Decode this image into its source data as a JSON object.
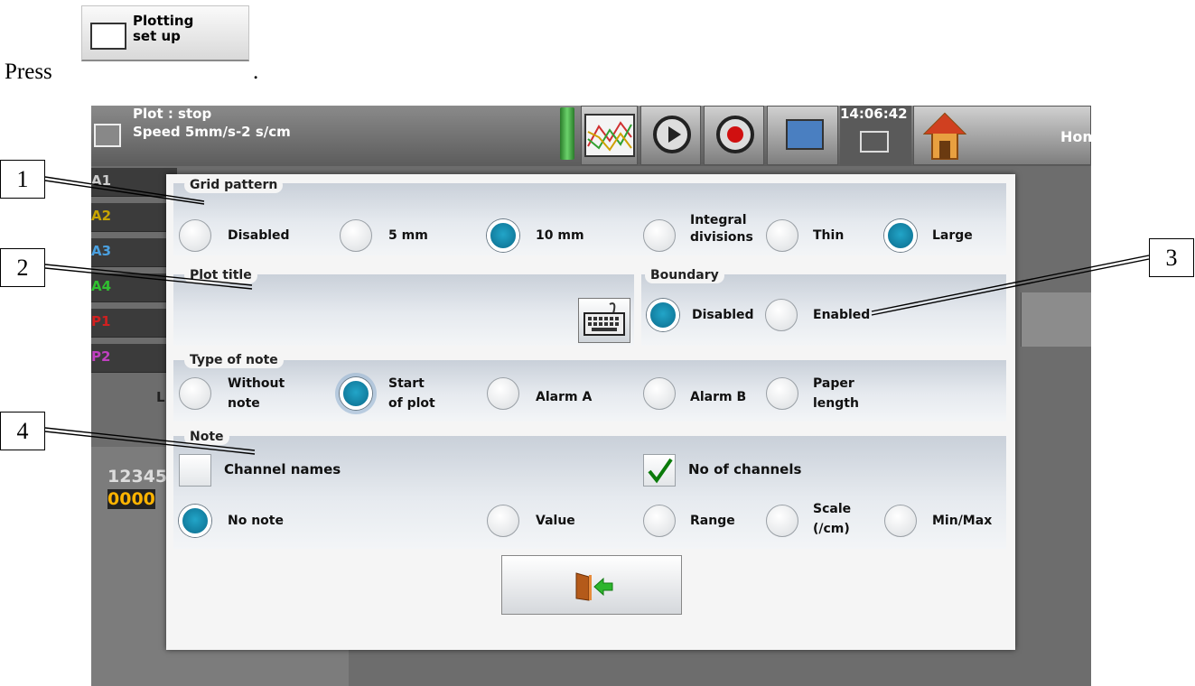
{
  "instruction": {
    "press_word": "Press",
    "button_label_line1": "Plotting",
    "button_label_line2": "set up",
    "period": "."
  },
  "status": {
    "line1": "Plot : stop",
    "line2": "Speed 5mm/s-2 s/cm"
  },
  "toolbar": {
    "icons": [
      "chart-icon",
      "play-icon",
      "record-icon",
      "monitor-icon"
    ],
    "clock": "14:06:42",
    "home_label": "Home"
  },
  "background": {
    "channels": [
      {
        "label": "A1",
        "color": "#cccccc"
      },
      {
        "label": "A2",
        "color": "#c8a400"
      },
      {
        "label": "A3",
        "color": "#4aa0e0"
      },
      {
        "label": "A4",
        "color": "#30c030"
      },
      {
        "label": "P1",
        "color": "#d02020"
      },
      {
        "label": "P2",
        "color": "#c040c0"
      }
    ],
    "low_letter": "L",
    "number1": "12345",
    "number2": "0000"
  },
  "dialog": {
    "grid": {
      "title": "Grid pattern",
      "options": [
        {
          "label": "Disabled",
          "selected": false
        },
        {
          "label": "5 mm",
          "selected": false
        },
        {
          "label": "10 mm",
          "selected": true
        },
        {
          "label": "Integral divisions",
          "line1": "Integral",
          "line2": "divisions",
          "selected": false
        },
        {
          "label": "Thin",
          "selected": false
        },
        {
          "label": "Large",
          "selected": true
        }
      ]
    },
    "plot_title": {
      "title": "Plot title",
      "value": ""
    },
    "boundary": {
      "title": "Boundary",
      "options": [
        {
          "label": "Disabled",
          "selected": true
        },
        {
          "label": "Enabled",
          "selected": false
        }
      ]
    },
    "type_of_note": {
      "title": "Type of note",
      "options": [
        {
          "line1": "Without",
          "line2": "note",
          "selected": false
        },
        {
          "line1": "Start",
          "line2": "of plot",
          "selected": true
        },
        {
          "label": "Alarm A",
          "selected": false
        },
        {
          "label": "Alarm B",
          "selected": false
        },
        {
          "line1": "Paper",
          "line2": "length",
          "selected": false
        }
      ]
    },
    "note": {
      "title": "Note",
      "checkboxes": [
        {
          "label": "Channel names",
          "checked": false
        },
        {
          "label": "No of channels",
          "checked": true
        }
      ],
      "options": [
        {
          "label": "No note",
          "selected": true
        },
        {
          "label": "Value",
          "selected": false
        },
        {
          "label": "Range",
          "selected": false
        },
        {
          "line1": "Scale",
          "line2": "(/cm)",
          "selected": false
        },
        {
          "label": "Min/Max",
          "selected": false
        }
      ]
    }
  },
  "callouts": [
    "1",
    "2",
    "3",
    "4"
  ]
}
